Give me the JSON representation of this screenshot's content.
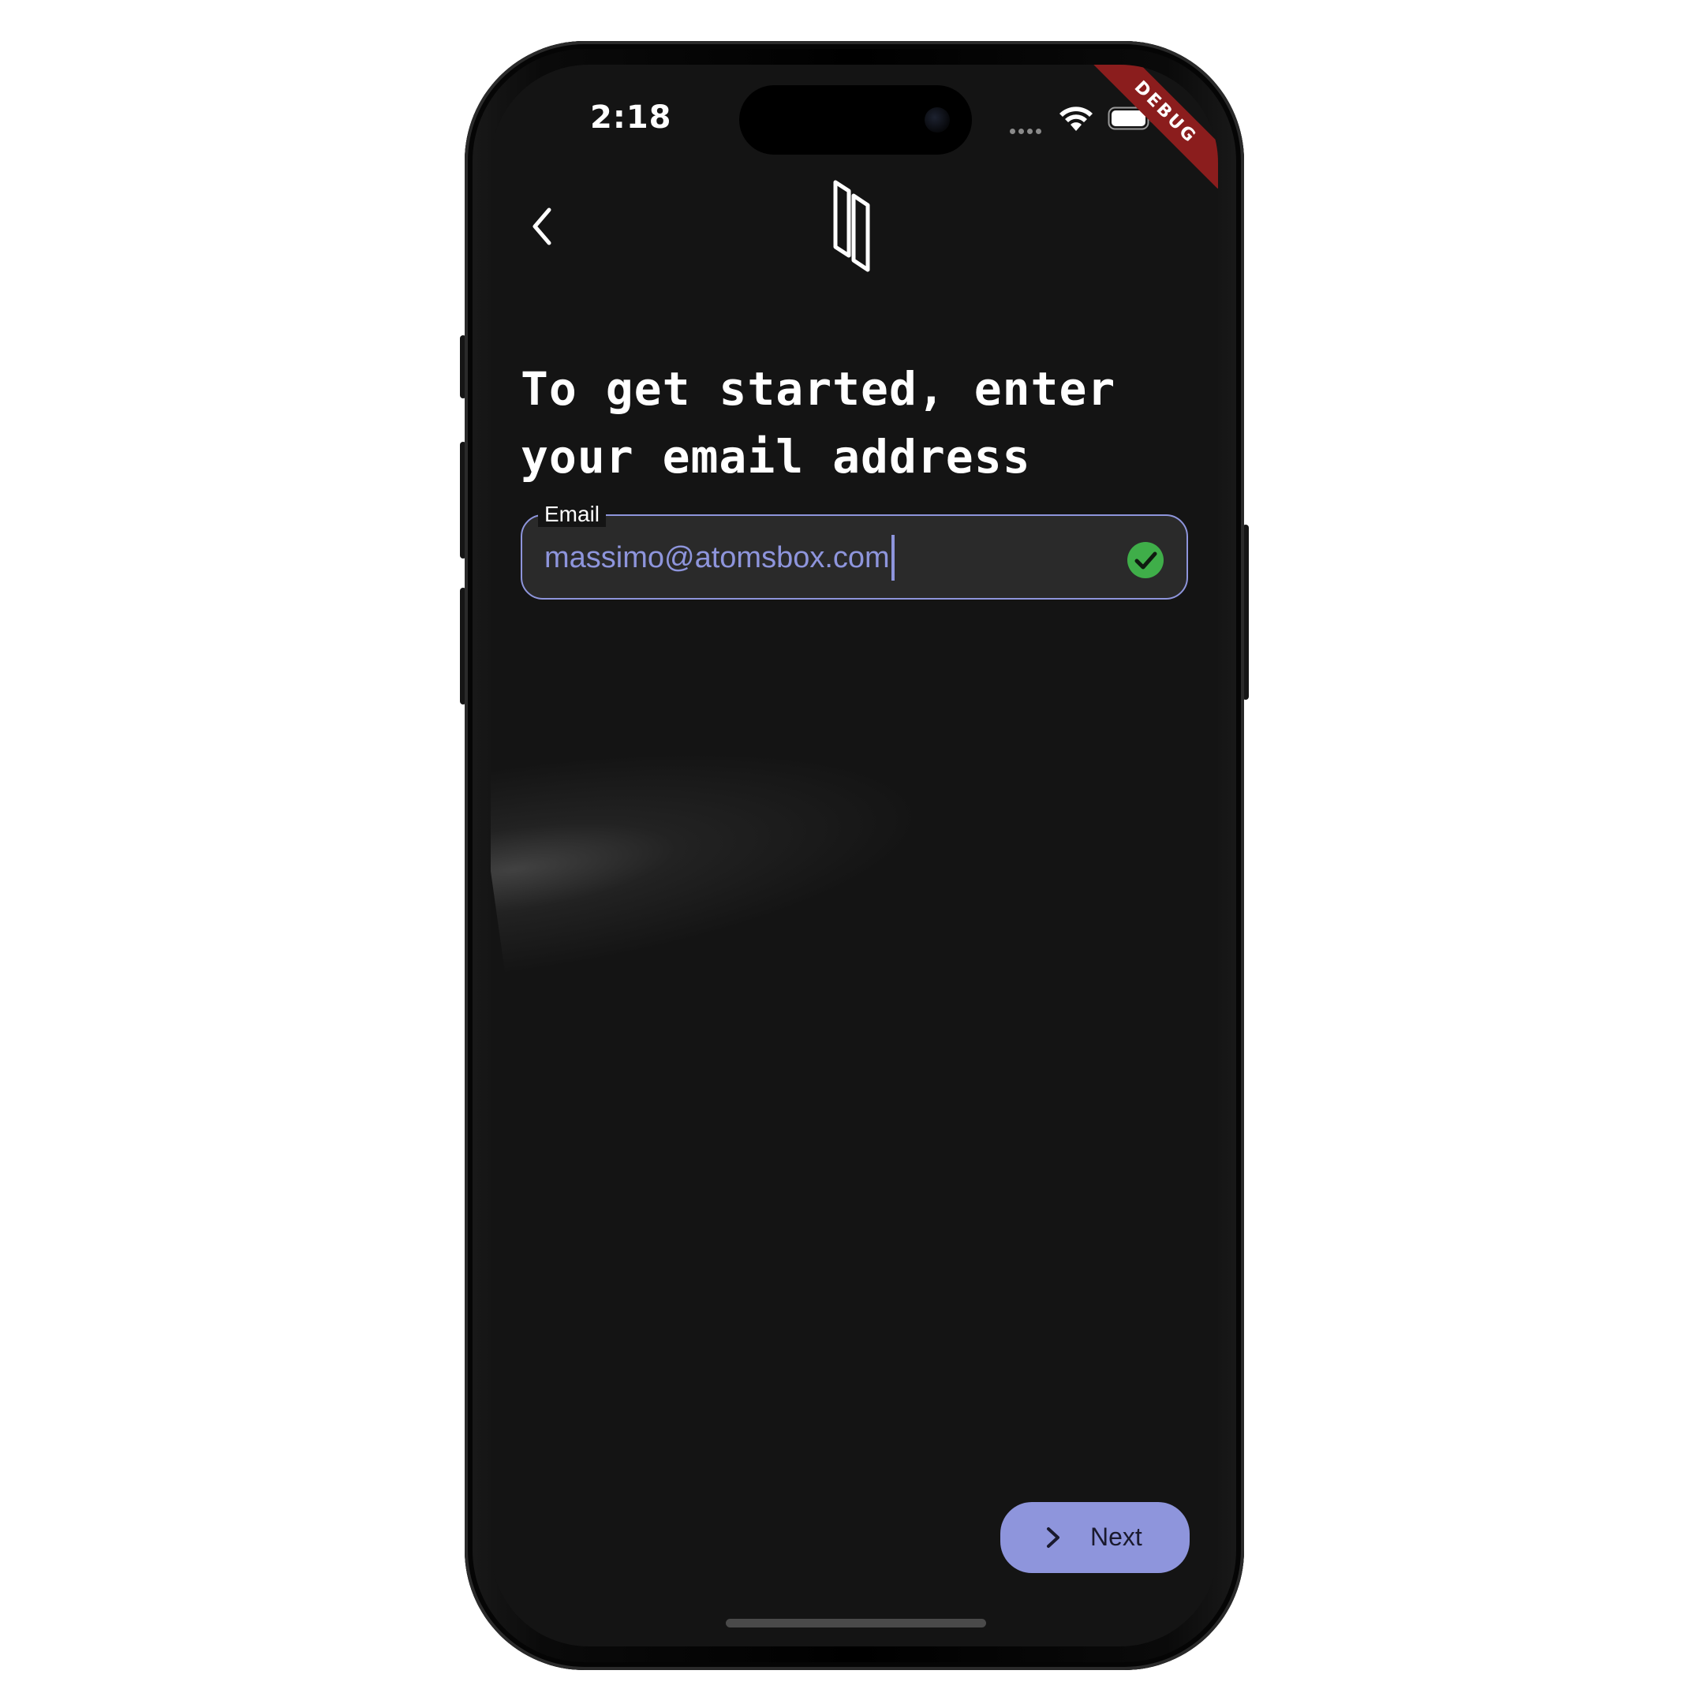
{
  "status_bar": {
    "time": "2:18",
    "wifi_icon": "wifi-icon",
    "battery_icon": "battery-icon",
    "debug_label": "DEBUG"
  },
  "app_bar": {
    "back_icon": "chevron-left-icon",
    "logo_icon": "app-logo"
  },
  "heading": "To get started, enter your email address",
  "email_field": {
    "label": "Email",
    "value": "massimo@atomsbox.com",
    "status_icon": "check-circle-icon",
    "status_color": "#3fae49",
    "accent_color": "#8e95dc"
  },
  "next_button": {
    "label": "Next",
    "icon": "chevron-right-icon",
    "background": "#8e95dc"
  }
}
